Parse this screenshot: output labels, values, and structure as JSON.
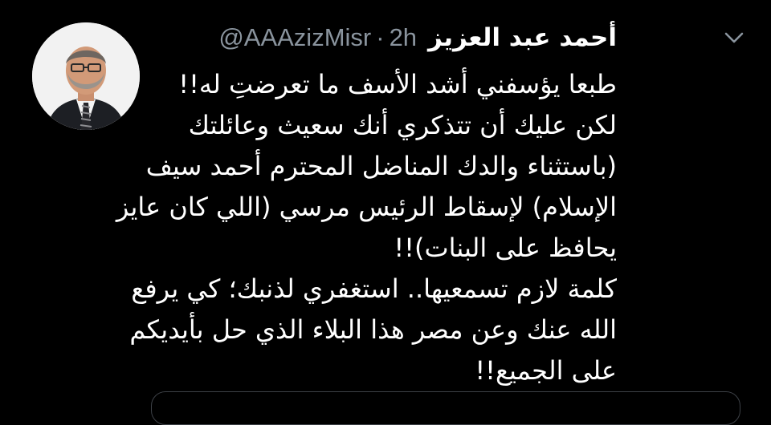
{
  "tweet": {
    "display_name": "أحمد عبد العزيز",
    "handle": "@AAAzizMisr",
    "separator": "·",
    "time": "2h",
    "lines": [
      "طبعا يؤسفني أشد الأسف ما تعرضتِ له!!",
      "لكن عليك أن تتذكري أنك سعيث وعائلتك",
      "(باستثناء والدك المناضل المحترم أحمد سيف",
      "الإسلام) لإسقاط الرئيس مرسي (اللي كان عايز",
      "يحافظ على البنات)!!",
      "كلمة لازم تسمعيها.. استغفري لذنبك؛ كي يرفع",
      "الله عنك وعن مصر هذا البلاء الذي حل بأيديكم",
      "على الجميع!!"
    ]
  },
  "icons": {
    "avatar": "profile-photo",
    "more": "chevron-down-icon"
  },
  "colors": {
    "background": "#000000",
    "text": "#ffffff",
    "secondary": "#8a949e",
    "border": "#3d4147"
  }
}
